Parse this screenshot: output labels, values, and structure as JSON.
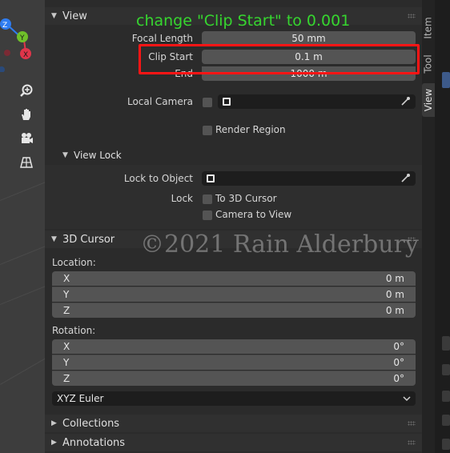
{
  "gizmo": {
    "z_label": "Z",
    "y_label": "Y",
    "x_label": "X"
  },
  "viewport_tools": [
    {
      "icon": "zoom-icon",
      "glyph": "⊕"
    },
    {
      "icon": "hand-icon",
      "glyph": "✋"
    },
    {
      "icon": "camera-icon",
      "glyph": "🎥"
    },
    {
      "icon": "grid-icon",
      "glyph": "▦"
    }
  ],
  "tabs": {
    "item": "Item",
    "tool": "Tool",
    "view": "View"
  },
  "view_section": {
    "title": "View",
    "focal_length_label": "Focal Length",
    "focal_length_value": "50 mm",
    "clip_start_label": "Clip Start",
    "clip_start_value": "0.1 m",
    "end_label": "End",
    "end_value": "1000 m",
    "local_camera_label": "Local Camera",
    "render_region_label": "Render Region"
  },
  "view_lock": {
    "title": "View Lock",
    "lock_to_object_label": "Lock to Object",
    "lock_label": "Lock",
    "to_3d_cursor_label": "To 3D Cursor",
    "camera_to_view_label": "Camera to View"
  },
  "cursor_section": {
    "title": "3D Cursor",
    "location_label": "Location:",
    "location": [
      {
        "axis": "X",
        "value": "0 m"
      },
      {
        "axis": "Y",
        "value": "0 m"
      },
      {
        "axis": "Z",
        "value": "0 m"
      }
    ],
    "rotation_label": "Rotation:",
    "rotation": [
      {
        "axis": "X",
        "value": "0°"
      },
      {
        "axis": "Y",
        "value": "0°"
      },
      {
        "axis": "Z",
        "value": "0°"
      }
    ],
    "rotation_mode": "XYZ Euler"
  },
  "collections_title": "Collections",
  "annotations_title": "Annotations",
  "annotation_text": "change \"Clip Start\" to 0.001",
  "watermark_text": "©2021 Rain Alderbury",
  "colors": {
    "annotation": "#36d62f",
    "highlight": "#ff1515",
    "panel": "#2b2b2b"
  }
}
